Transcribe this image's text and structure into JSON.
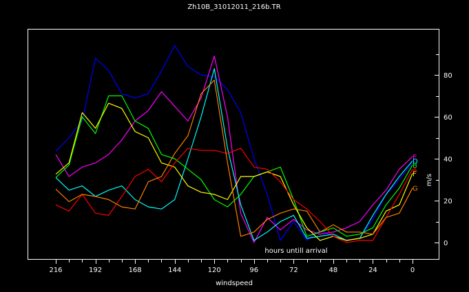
{
  "chart_data": {
    "type": "line",
    "title": "Zh10B_31012011_216b.TR",
    "xlabel": "windspeed",
    "ylabel": "m/s",
    "annotation": "hours untill arrival",
    "xlim": [
      216,
      0
    ],
    "ylim": [
      -7,
      97
    ],
    "x_ticks": [
      216,
      192,
      168,
      144,
      120,
      96,
      72,
      48,
      24,
      0
    ],
    "y_ticks": [
      0,
      20,
      40,
      60,
      80
    ],
    "grid": false,
    "x": [
      216,
      208,
      200,
      192,
      184,
      176,
      168,
      160,
      152,
      144,
      136,
      128,
      120,
      112,
      104,
      96,
      88,
      80,
      72,
      64,
      56,
      48,
      40,
      32,
      24,
      16,
      8,
      0
    ],
    "series": [
      {
        "name": "C",
        "color": "#0000ff",
        "values": [
          43.5,
          50,
          58,
          88,
          82,
          71,
          69,
          71,
          82,
          94,
          84,
          80,
          79,
          73,
          62,
          40,
          23,
          1,
          10,
          1,
          6,
          3,
          1,
          2,
          11,
          23,
          30,
          38
        ]
      },
      {
        "name": "E",
        "color": "#ff00ff",
        "values": [
          42,
          31.5,
          36,
          38,
          42,
          49,
          58,
          63,
          72,
          65,
          58,
          69,
          89,
          60,
          14,
          0,
          12,
          6,
          11,
          6,
          4,
          5,
          7,
          10,
          18,
          25,
          35,
          41
        ]
      },
      {
        "name": "D",
        "color": "#00ffff",
        "values": [
          31,
          25,
          27,
          22,
          25,
          27,
          20.5,
          17,
          16,
          20.5,
          40,
          60,
          83,
          45,
          18,
          1,
          5,
          10,
          13,
          2,
          3,
          4,
          1,
          2,
          13,
          23,
          31.5,
          39
        ]
      },
      {
        "name": "B",
        "color": "#00ff00",
        "values": [
          31,
          37,
          60,
          52,
          70,
          70,
          58,
          54.5,
          42,
          40,
          35,
          30,
          20.5,
          17,
          23,
          31.5,
          33.7,
          36,
          20.5,
          3,
          5,
          7,
          3,
          4,
          7,
          18,
          26,
          37
        ]
      },
      {
        "name": "F",
        "color": "#ffff00",
        "values": [
          32.6,
          38,
          62,
          54.5,
          66.5,
          64,
          53,
          50,
          38,
          36,
          27,
          24,
          23,
          20.5,
          31.5,
          31.5,
          33.7,
          31.5,
          18,
          7,
          1,
          3,
          1,
          2,
          4,
          15,
          18,
          33
        ]
      },
      {
        "name": "A",
        "color": "#ff0000",
        "values": [
          18,
          15,
          23,
          14,
          13,
          22,
          31.5,
          35,
          29,
          38,
          45,
          44,
          44,
          42.5,
          45,
          36,
          35,
          29,
          20.5,
          16,
          10,
          3,
          0,
          1,
          1,
          12,
          23,
          35
        ]
      },
      {
        "name": "G",
        "color": "#ff8000",
        "values": [
          25.5,
          19.5,
          23,
          22,
          20.5,
          17,
          16,
          29,
          31.5,
          42.5,
          51,
          71,
          77.5,
          38,
          3,
          5,
          11,
          14,
          16,
          15,
          5,
          8.5,
          5,
          5,
          4,
          12,
          14,
          26
        ]
      }
    ]
  }
}
